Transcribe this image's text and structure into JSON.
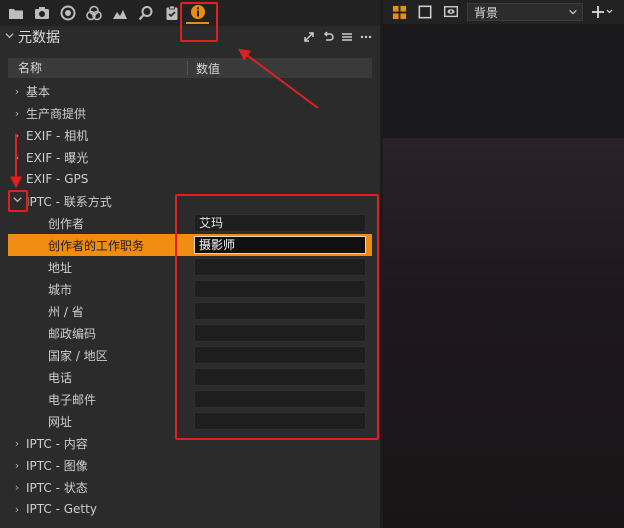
{
  "toolbar": {
    "icons": [
      "folder-icon",
      "camera-icon",
      "lens-icon",
      "color-icon",
      "exposure-icon",
      "search-icon",
      "clipboard-icon",
      "info-icon"
    ],
    "active_color": "#e8900e"
  },
  "panel": {
    "title": "元数据"
  },
  "columns": {
    "name": "名称",
    "value": "数值"
  },
  "tree": {
    "basic": "基本",
    "manufacturer": "生产商提供",
    "exif_camera": "EXIF - 相机",
    "exif_exposure": "EXIF - 曝光",
    "exif_gps": "EXIF - GPS",
    "iptc_contact": "IPTC - 联系方式",
    "fields": [
      {
        "label": "创作者",
        "value": "艾玛"
      },
      {
        "label": "创作者的工作职务",
        "value": "摄影师"
      },
      {
        "label": "地址",
        "value": ""
      },
      {
        "label": "城市",
        "value": ""
      },
      {
        "label": "州 / 省",
        "value": ""
      },
      {
        "label": "邮政编码",
        "value": ""
      },
      {
        "label": "国家 / 地区",
        "value": ""
      },
      {
        "label": "电话",
        "value": ""
      },
      {
        "label": "电子邮件",
        "value": ""
      },
      {
        "label": "网址",
        "value": ""
      }
    ],
    "iptc_content": "IPTC - 内容",
    "iptc_image": "IPTC - 图像",
    "iptc_status": "IPTC - 状态",
    "iptc_getty": "IPTC - Getty"
  },
  "viewer": {
    "background_select": "背景"
  },
  "colors": {
    "highlight": "#f08c12",
    "annotation": "#e02020"
  }
}
